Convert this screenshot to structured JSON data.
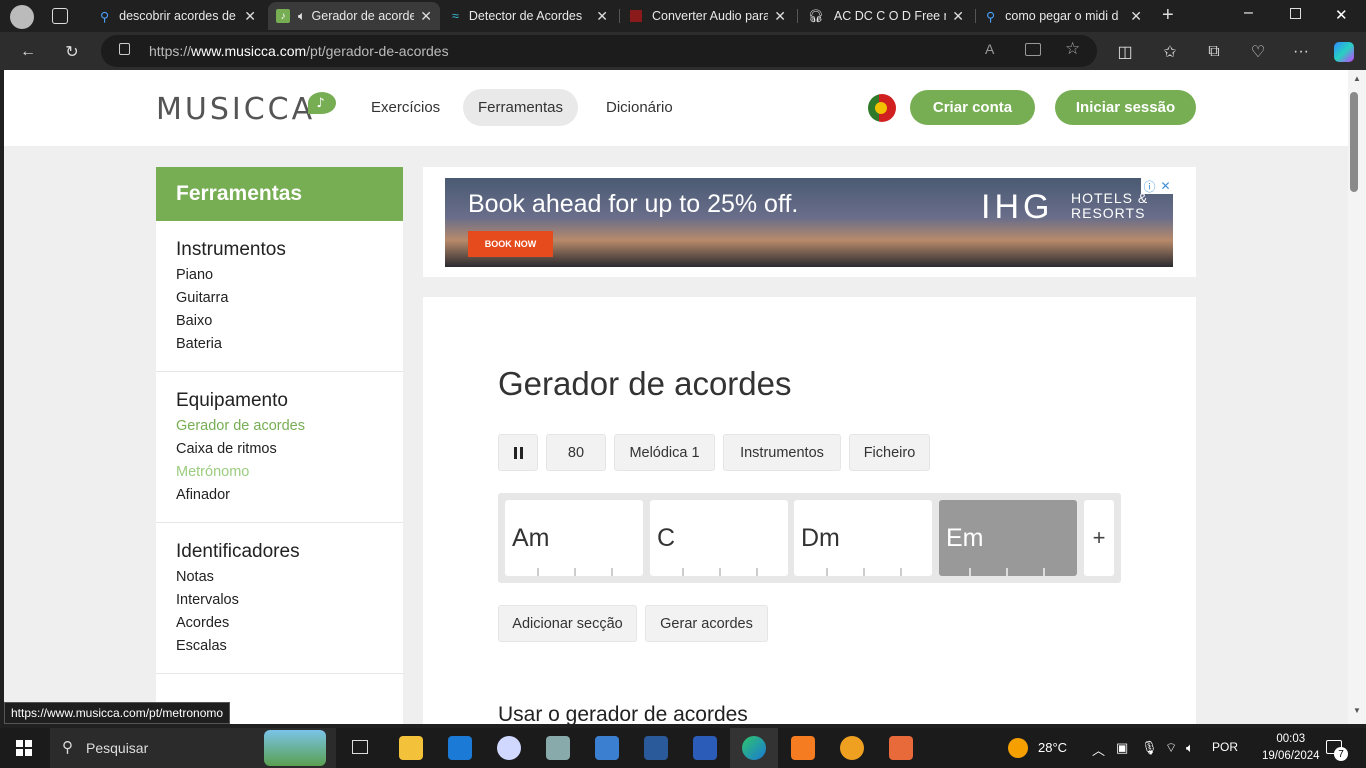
{
  "tabs": [
    {
      "title": "descobrir acordes de",
      "icon": "search-icon"
    },
    {
      "title": "Gerador de acordes",
      "icon": "music-note-icon",
      "active": true
    },
    {
      "title": "Detector de Acordes",
      "icon": "wave-icon"
    },
    {
      "title": "Converter Audio para",
      "icon": "audio-converter-icon"
    },
    {
      "title": "AC DC C O D Free mi",
      "icon": "headphones-icon"
    },
    {
      "title": "como pegar o midi d",
      "icon": "search-icon"
    }
  ],
  "address": {
    "prefix": "https://",
    "host": "www.musicca.com",
    "path": "/pt/gerador-de-acordes"
  },
  "header": {
    "logo": "MUSICCA",
    "nav": [
      "Exercícios",
      "Ferramentas",
      "Dicionário"
    ],
    "create_account": "Criar conta",
    "login": "Iniciar sessão"
  },
  "sidebar": {
    "title": "Ferramentas",
    "sections": [
      {
        "heading": "Instrumentos",
        "items": [
          "Piano",
          "Guitarra",
          "Baixo",
          "Bateria"
        ]
      },
      {
        "heading": "Equipamento",
        "items": [
          "Gerador de acordes",
          "Caixa de ritmos",
          "Metrónomo",
          "Afinador"
        ]
      },
      {
        "heading": "Identificadores",
        "items": [
          "Notas",
          "Intervalos",
          "Acordes",
          "Escalas"
        ]
      }
    ]
  },
  "ad": {
    "headline": "Book ahead for up to 25% off.",
    "button": "BOOK NOW",
    "brand": "IHG",
    "brand_sub1": "HOTELS &",
    "brand_sub2": "RESORTS"
  },
  "main": {
    "title": "Gerador de acordes",
    "tempo": "80",
    "sound": "Melódica 1",
    "instruments": "Instrumentos",
    "file": "Ficheiro",
    "chords": [
      "Am",
      "C",
      "Dm",
      "Em"
    ],
    "add_chord": "+",
    "add_section": "Adicionar secção",
    "generate": "Gerar acordes",
    "subtitle": "Usar o gerador de acordes"
  },
  "status_url": "https://www.musicca.com/pt/metronomo",
  "taskbar": {
    "search": "Pesquisar",
    "temp": "28°C",
    "lang": "POR",
    "time": "00:03",
    "date": "19/06/2024",
    "notifications": "7"
  }
}
